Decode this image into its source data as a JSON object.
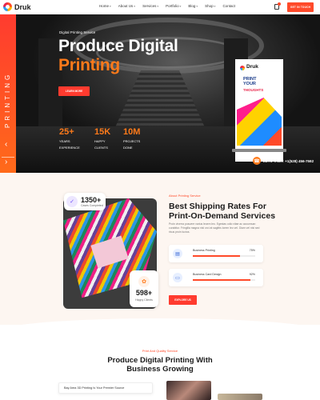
{
  "brand": {
    "name": "Druk"
  },
  "nav": {
    "items": [
      {
        "label": "Home",
        "active": true,
        "caret": true
      },
      {
        "label": "About Us",
        "active": false,
        "caret": true
      },
      {
        "label": "Services",
        "active": false,
        "caret": true
      },
      {
        "label": "Portfolio",
        "active": false,
        "caret": true
      },
      {
        "label": "Blog",
        "active": false,
        "caret": true
      },
      {
        "label": "Shop",
        "active": false,
        "caret": true
      },
      {
        "label": "Contact",
        "active": false,
        "caret": false
      }
    ],
    "cta": "GET IN TOUCH",
    "cart_icon": "cart-icon"
  },
  "hero": {
    "side_text": "PRINTING",
    "subtitle": "Digital Printing Service",
    "title_line1": "Produce Digital",
    "title_line2": "Printing",
    "button": "LEARN MORE",
    "stats": [
      {
        "num": "25+",
        "label1": "YEARS",
        "label2": "EXPERIENCE"
      },
      {
        "num": "15K",
        "label1": "HAPPY",
        "label2": "CLIENTS"
      },
      {
        "num": "10M",
        "label1": "PROJECTS",
        "label2": "DONE"
      }
    ],
    "banner": {
      "brand": "Druk",
      "line1": "PRINT",
      "line2": "YOUR",
      "line3": "THOUGHTS"
    },
    "lets_talk": "LETS TALK: +1(528) 456-7592",
    "arrow_prev": "‹",
    "arrow_next": "›"
  },
  "about": {
    "badge_top": {
      "num": "1350+",
      "label": "Cases Completed"
    },
    "badge_bottom": {
      "num": "598+",
      "label": "Happy Clients"
    },
    "tag": "About Printing Service",
    "heading_line1": "Best Shipping Rates For",
    "heading_line2": "Print-On-Demand Services",
    "body": "Proin viverra posuere varius leoem leo. Egestas odio vitae ac accumsan curabitur. Fringilla magna nisl orci at sagittis lorem leo vel. Diam vel nisi sed risus proin luctus.",
    "skills": [
      {
        "label": "Business Printing",
        "percent": 75,
        "percent_label": "75%"
      },
      {
        "label": "Business Card Design",
        "percent": 92,
        "percent_label": "92%"
      }
    ],
    "button": "EXPLORE US"
  },
  "section3": {
    "tag": "Print And Quality Service",
    "heading_line1": "Produce Digital Printing With",
    "heading_line2": "Business Growing",
    "field_text": "Bay Area 3D Printing Is Your Premier Source"
  },
  "colors": {
    "accent": "#ff4a2a",
    "hero_highlight": "#ff7a1a",
    "dark": "#161616",
    "about_bg": "#fdf6f1"
  }
}
